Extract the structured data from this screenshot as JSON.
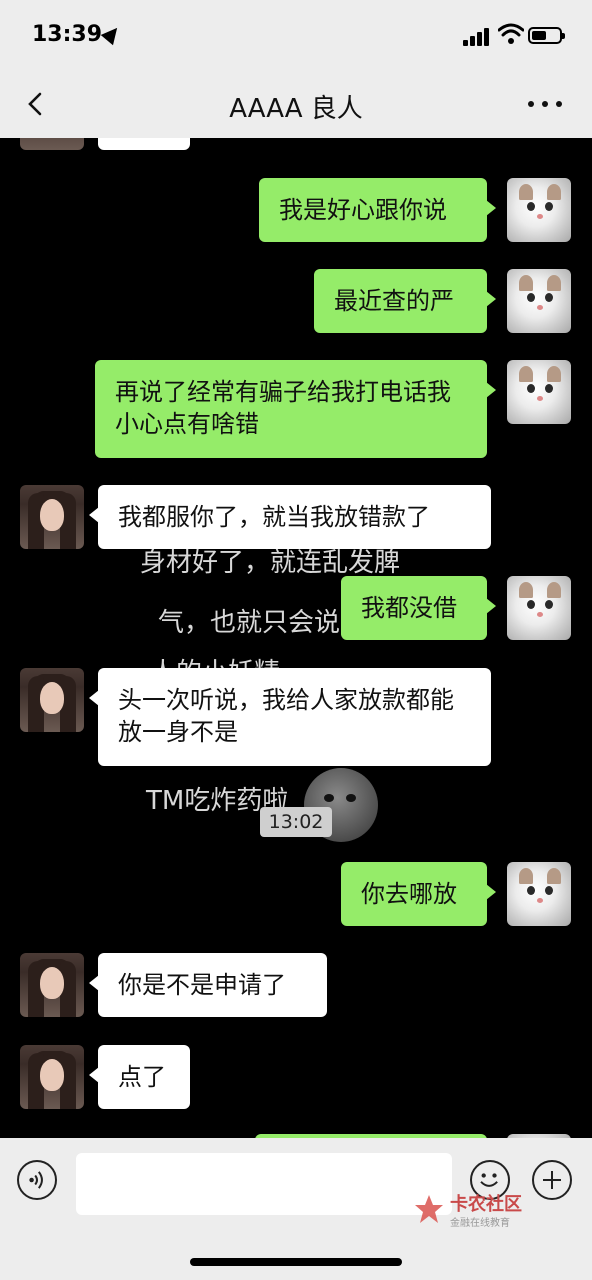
{
  "status_bar": {
    "time": "13:39"
  },
  "header": {
    "title": "AAAA 良人"
  },
  "background_text": [
    "身材好了，就连乱发脾",
    "气，也就只会说",
    "人的小妖精",
    "TM吃炸药啦"
  ],
  "messages": [
    {
      "sender": "me",
      "text": "我是好心跟你说"
    },
    {
      "sender": "me",
      "text": "最近查的严"
    },
    {
      "sender": "me",
      "text": "再说了经常有骗子给我打电话我小心点有啥错"
    },
    {
      "sender": "them",
      "text": "我都服你了，就当我放错款了"
    },
    {
      "sender": "me",
      "text": "我都没借"
    },
    {
      "sender": "them",
      "text": "头一次听说，我给人家放款都能放一身不是"
    },
    {
      "sender": "me",
      "text": "你去哪放"
    },
    {
      "sender": "them",
      "text": "你是不是申请了"
    },
    {
      "sender": "them",
      "text": "点了"
    }
  ],
  "video_timestamp": "13:02",
  "watermark": {
    "title": "卡农社区",
    "subtitle": "金融在线教育"
  },
  "colors": {
    "my_bubble": "#95ec69",
    "their_bubble": "#ffffff",
    "bar_bg": "#ededed",
    "chat_bg": "#000000"
  },
  "icons": [
    "back-icon",
    "more-icon",
    "voice-icon",
    "emoji-icon",
    "plus-icon"
  ]
}
